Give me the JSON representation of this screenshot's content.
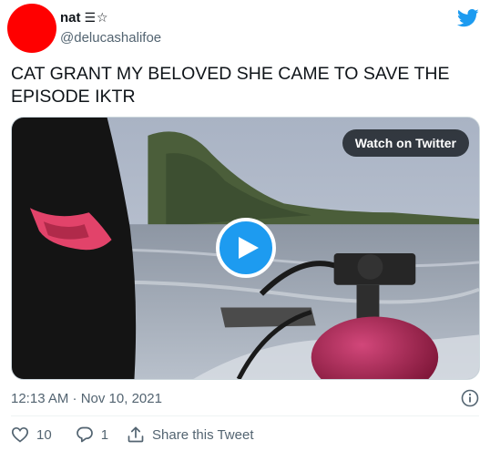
{
  "author": {
    "display_name": "nat",
    "name_emoji": "☰☆",
    "handle": "@delucashalifoe",
    "avatar_color": "#ff0000"
  },
  "tweet": {
    "text": "CAT GRANT MY BELOVED SHE CAME TO SAVE THE EPISODE IKTR",
    "timestamp": "12:13 AM · Nov 10, 2021"
  },
  "media": {
    "watch_label": "Watch on Twitter",
    "type": "video"
  },
  "actions": {
    "like_count": "10",
    "reply_count": "1",
    "share_label": "Share this Tweet"
  },
  "icons": {
    "brand": "twitter-bird-icon",
    "play": "play-icon",
    "info": "info-icon",
    "like": "heart-icon",
    "reply": "reply-bubble-icon",
    "share": "share-upload-icon"
  },
  "colors": {
    "brand": "#1d9bf0",
    "text": "#0f1419",
    "secondary": "#536471"
  }
}
